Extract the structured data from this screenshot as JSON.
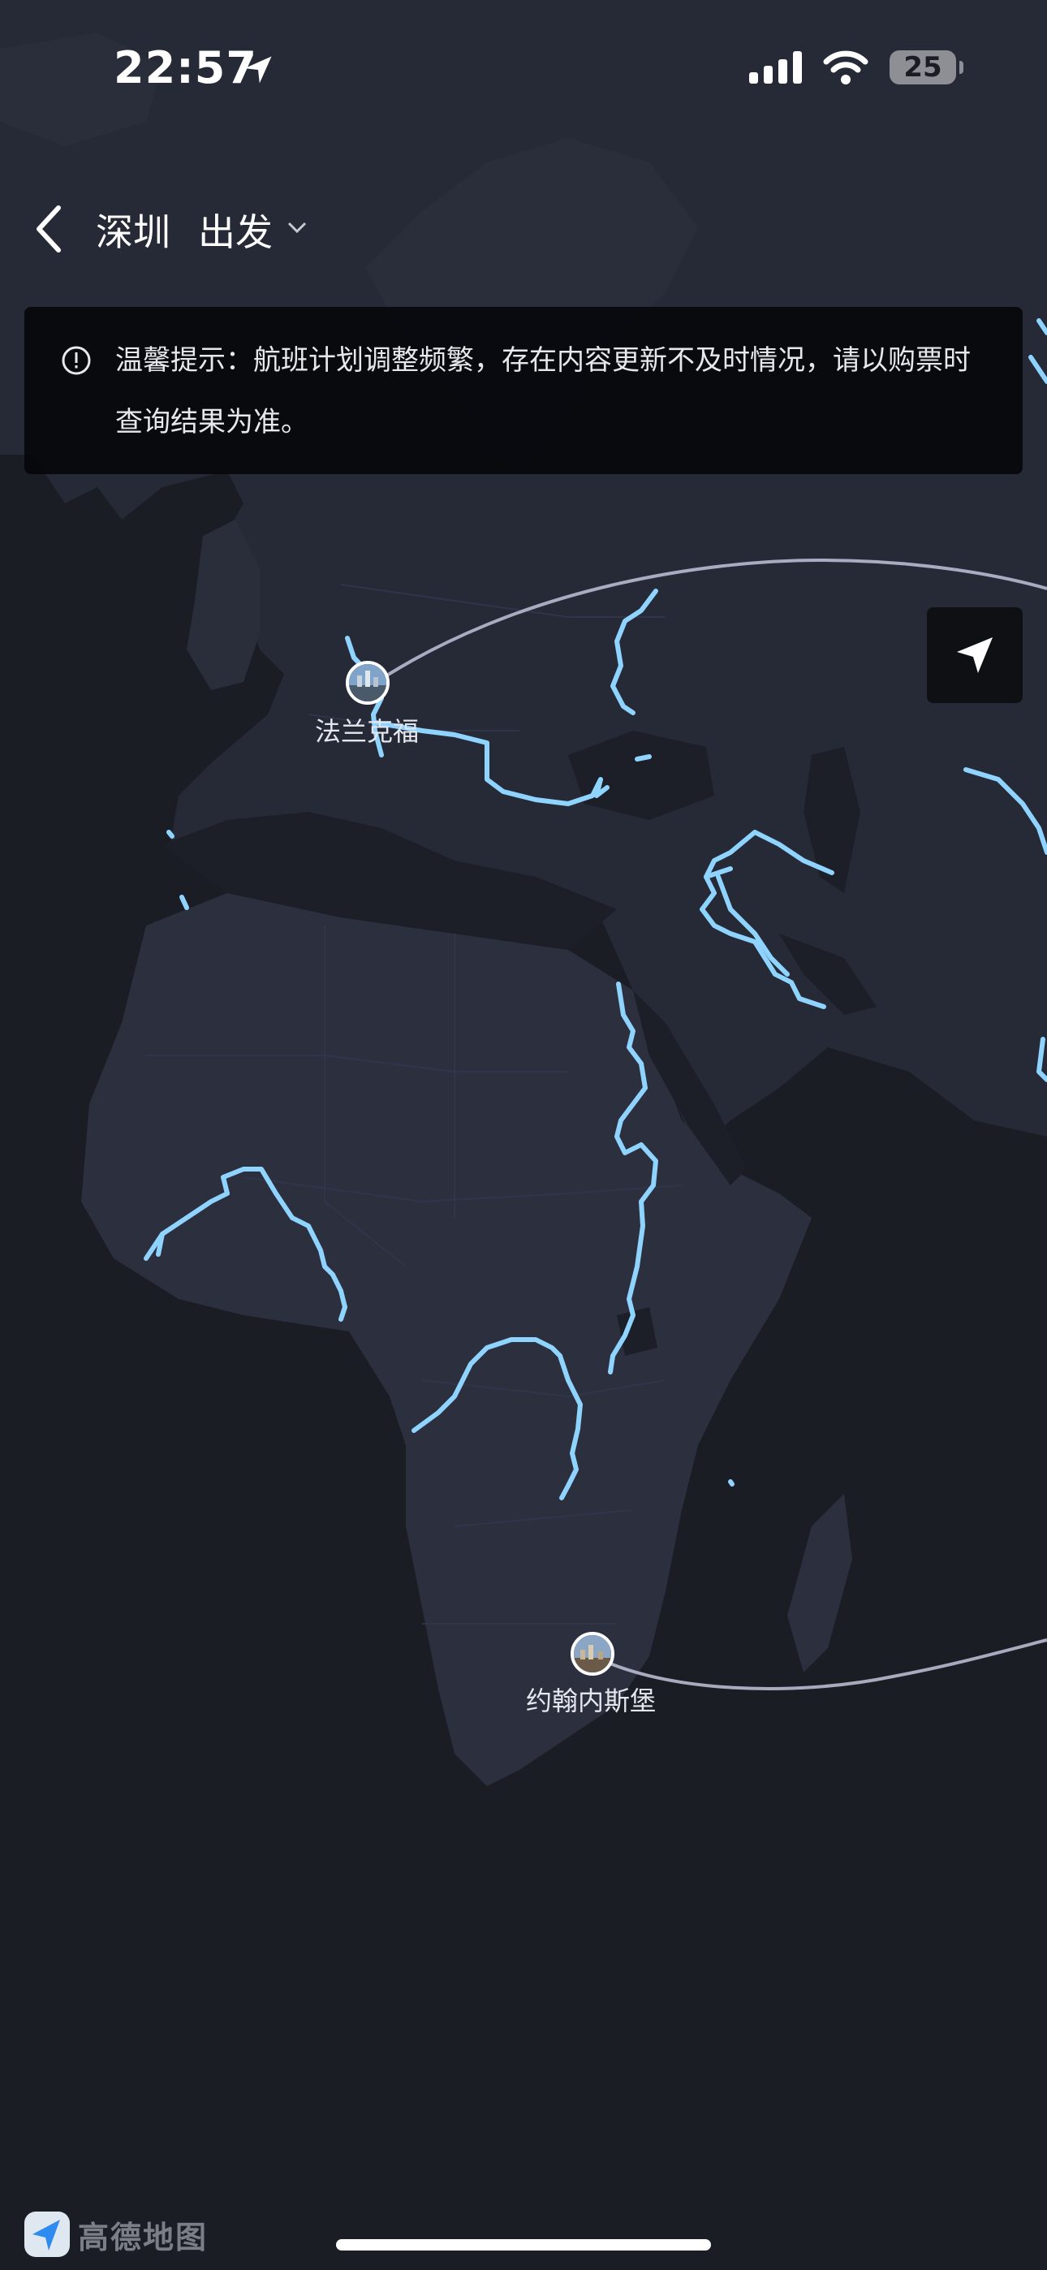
{
  "status_bar": {
    "time": "22:57",
    "battery": "25"
  },
  "header": {
    "city": "深圳",
    "mode": "出发"
  },
  "notice": {
    "text": "温馨提示：航班计划调整频繁，存在内容更新不及时情况，请以购票时查询结果为准。"
  },
  "destinations": [
    {
      "name": "法兰克福"
    },
    {
      "name": "约翰内斯堡"
    }
  ],
  "brand": {
    "name": "高德地图"
  },
  "icons": {
    "back": "chevron-left-icon",
    "dropdown": "chevron-down-icon",
    "notice": "info-circle-icon",
    "locate": "navigation-arrow-icon",
    "location": "location-arrow-icon",
    "signal": "cellular-signal-icon",
    "wifi": "wifi-icon"
  },
  "colors": {
    "background": "#1b1d25",
    "land": "#262a37",
    "river": "#8fd3ff",
    "route": "#b8bacf"
  }
}
